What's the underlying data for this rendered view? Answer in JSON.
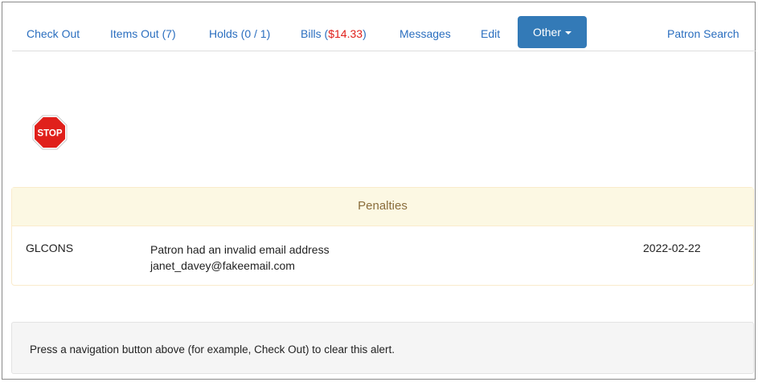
{
  "nav": {
    "tabs": [
      {
        "label": "Check Out"
      },
      {
        "label": "Items Out (7)"
      },
      {
        "label": "Holds (0 / 1)"
      },
      {
        "label_prefix": "Bills (",
        "amount": "$14.33",
        "label_suffix": ")"
      },
      {
        "label": "Messages"
      },
      {
        "label": "Edit"
      }
    ],
    "other": {
      "label": "Other"
    },
    "patron_search": "Patron Search"
  },
  "stop_sign": {
    "text": "STOP",
    "color": "#e0201b"
  },
  "penalties": {
    "heading": "Penalties",
    "rows": [
      {
        "code": "GLCONS",
        "note_line1": "Patron had an invalid email address",
        "note_line2": "janet_davey@fakeemail.com",
        "date": "2022-02-22"
      }
    ]
  },
  "alert": {
    "text": "Press a navigation button above (for example, Check Out) to clear this alert."
  },
  "colors": {
    "link": "#2a6ebf",
    "bills_amount": "#e0201b",
    "primary_button": "#337ab7",
    "panel_heading_bg": "#fcf8e3",
    "panel_heading_text": "#8a6d3b"
  }
}
